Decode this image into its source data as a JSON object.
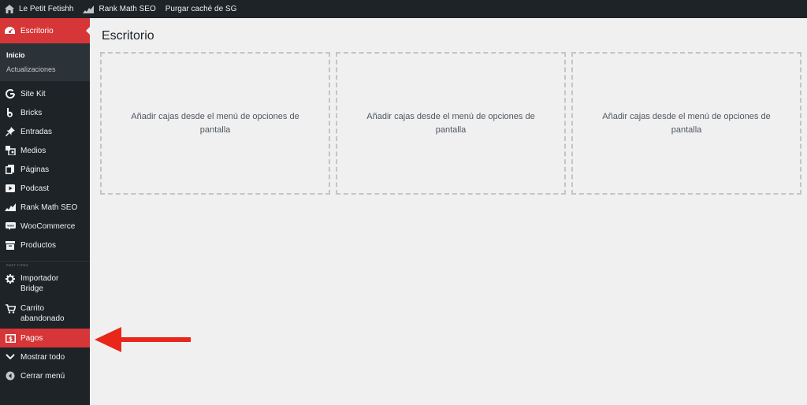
{
  "adminbar": {
    "site_name": "Le Petit Fetishh",
    "rankmath": "Rank Math SEO",
    "purge": "Purgar caché de SG"
  },
  "sidebar": {
    "current": "Escritorio",
    "submenu": [
      "Inicio",
      "Actualizaciones"
    ],
    "items": [
      {
        "label": "Site Kit",
        "icon": "google-g-icon"
      },
      {
        "label": "Bricks",
        "icon": "bricks-b-icon"
      },
      {
        "label": "Entradas",
        "icon": "pushpin-icon"
      },
      {
        "label": "Medios",
        "icon": "media-icon"
      },
      {
        "label": "Páginas",
        "icon": "pages-icon"
      },
      {
        "label": "Podcast",
        "icon": "video-play-icon"
      },
      {
        "label": "Rank Math SEO",
        "icon": "rankmath-icon"
      },
      {
        "label": "WooCommerce",
        "icon": "woo-icon"
      },
      {
        "label": "Productos",
        "icon": "archive-icon"
      }
    ],
    "separator": "POST TYPES",
    "items2": [
      {
        "label": "Importador Bridge",
        "icon": "gear-icon"
      },
      {
        "label": "Carrito abandonado",
        "icon": "cart-icon"
      },
      {
        "label": "Pagos",
        "icon": "dollar-icon"
      },
      {
        "label": "Mostrar todo",
        "icon": "chevron-down-icon"
      },
      {
        "label": "Cerrar menú",
        "icon": "collapse-icon"
      }
    ]
  },
  "main": {
    "title": "Escritorio",
    "boxes": [
      "Añadir cajas desde el menú de opciones de pantalla",
      "Añadir cajas desde el menú de opciones de pantalla",
      "Añadir cajas desde el menú de opciones de pantalla"
    ]
  },
  "colors": {
    "accent": "#d63638",
    "adminbar": "#1d2327",
    "background": "#f0f0f1",
    "arrow": "#e8261a"
  }
}
